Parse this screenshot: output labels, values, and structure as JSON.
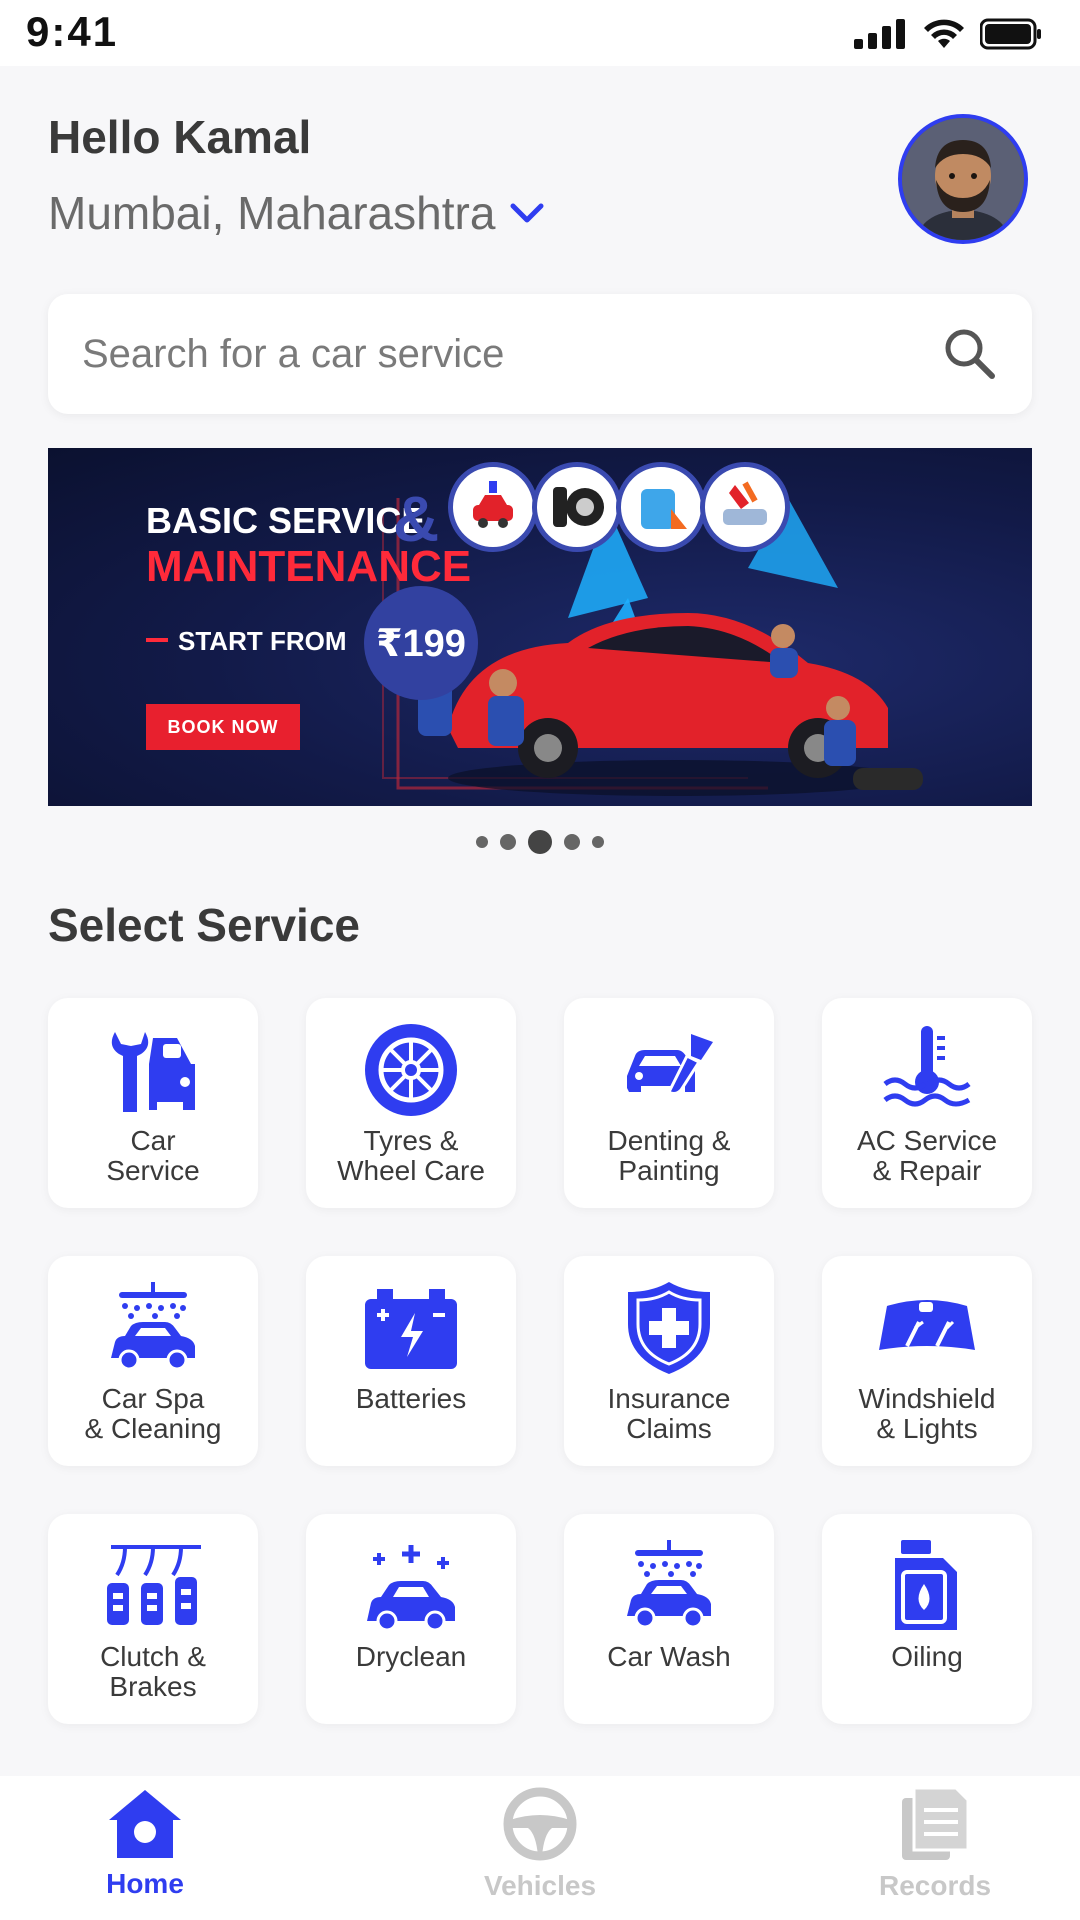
{
  "status_bar": {
    "time": "9:41"
  },
  "header": {
    "greeting": "Hello Kamal",
    "location": "Mumbai, Maharashtra"
  },
  "search": {
    "placeholder": "Search for a car service"
  },
  "banner": {
    "line1": "BASIC SERVICE",
    "amp": "&",
    "line2": "MAINTENANCE",
    "start_label": "START FROM",
    "price": "₹199",
    "cta": "BOOK NOW",
    "active_slide": 3,
    "slide_count": 5
  },
  "section": {
    "title": "Select Service"
  },
  "services": [
    {
      "label": "Car\nService",
      "icon": "car-service-icon"
    },
    {
      "label": "Tyres &\nWheel Care",
      "icon": "wheel-icon"
    },
    {
      "label": "Denting &\nPainting",
      "icon": "paint-brush-car-icon"
    },
    {
      "label": "AC Service\n& Repair",
      "icon": "thermometer-icon"
    },
    {
      "label": "Car Spa\n& Cleaning",
      "icon": "car-spa-icon"
    },
    {
      "label": "Batteries",
      "icon": "battery-icon"
    },
    {
      "label": "Insurance\nClaims",
      "icon": "shield-plus-icon"
    },
    {
      "label": "Windshield\n& Lights",
      "icon": "windshield-icon"
    },
    {
      "label": "Clutch &\nBrakes",
      "icon": "pedals-icon"
    },
    {
      "label": "Dryclean",
      "icon": "sparkle-car-icon"
    },
    {
      "label": "Car Wash",
      "icon": "car-wash-icon"
    },
    {
      "label": "Oiling",
      "icon": "oil-can-icon"
    }
  ],
  "bottom_nav": [
    {
      "label": "Home",
      "icon": "home-icon",
      "active": true
    },
    {
      "label": "Vehicles",
      "icon": "steering-wheel-icon",
      "active": false
    },
    {
      "label": "Records",
      "icon": "document-icon",
      "active": false
    }
  ],
  "colors": {
    "accent": "#2f3df0",
    "banner_red": "#e8202e",
    "background": "#f7f7f9"
  }
}
